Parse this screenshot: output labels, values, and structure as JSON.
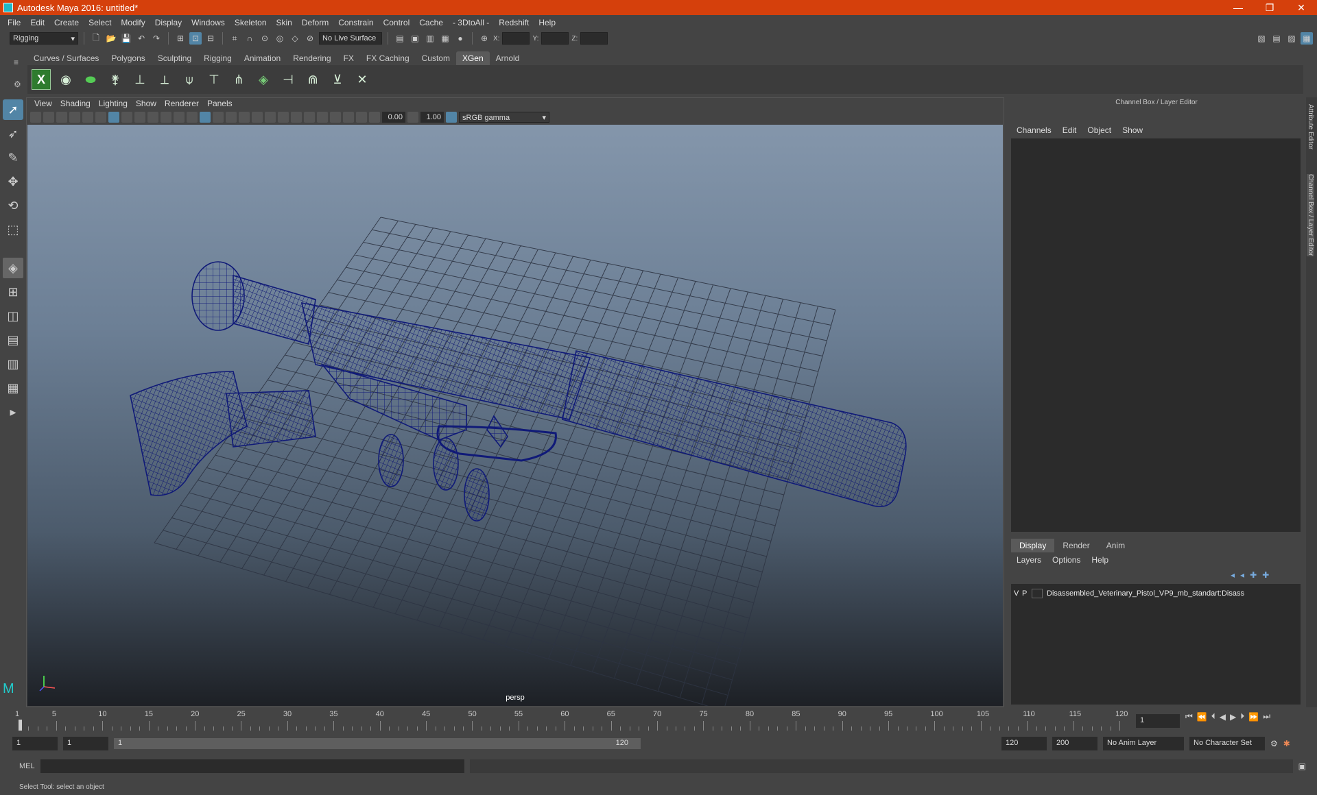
{
  "window": {
    "title": "Autodesk Maya 2016: untitled*"
  },
  "menubar": [
    "File",
    "Edit",
    "Create",
    "Select",
    "Modify",
    "Display",
    "Windows",
    "Skeleton",
    "Skin",
    "Deform",
    "Constrain",
    "Control",
    "Cache",
    "- 3DtoAll -",
    "Redshift",
    "Help"
  ],
  "statusline": {
    "menuset": "Rigging",
    "live_surface": "No Live Surface",
    "x_label": "X:",
    "y_label": "Y:",
    "z_label": "Z:"
  },
  "shelf": {
    "tabs": [
      "Curves / Surfaces",
      "Polygons",
      "Sculpting",
      "Rigging",
      "Animation",
      "Rendering",
      "FX",
      "FX Caching",
      "Custom",
      "XGen",
      "Arnold"
    ],
    "active_tab": "XGen",
    "icons": [
      "xgen-icon",
      "eye-icon",
      "leaf-icon",
      "guides-icon",
      "add-guide-icon",
      "place-icon",
      "sculpt-icon",
      "lock-icon",
      "grass-icon",
      "layers-icon",
      "spline-icon",
      "comb-icon",
      "cut-icon",
      "delete-icon"
    ]
  },
  "viewport": {
    "menu": [
      "View",
      "Shading",
      "Lighting",
      "Show",
      "Renderer",
      "Panels"
    ],
    "exposure": "0.00",
    "gamma": "1.00",
    "color_space": "sRGB gamma",
    "camera_label": "persp",
    "wire_color": "#101a78"
  },
  "channelbox": {
    "title": "Channel Box / Layer Editor",
    "menu": [
      "Channels",
      "Edit",
      "Object",
      "Show"
    ]
  },
  "layereditor": {
    "tabs": [
      "Display",
      "Render",
      "Anim"
    ],
    "active_tab": "Display",
    "menu": [
      "Layers",
      "Options",
      "Help"
    ],
    "layer": {
      "v": "V",
      "p": "P",
      "name": "Disassembled_Veterinary_Pistol_VP9_mb_standart:Disass"
    }
  },
  "sidetabs": {
    "attribute_editor": "Attribute Editor",
    "channel_box": "Channel Box / Layer Editor"
  },
  "timeline": {
    "labels": [
      "1",
      "5",
      "10",
      "15",
      "20",
      "25",
      "30",
      "35",
      "40",
      "45",
      "50",
      "55",
      "60",
      "65",
      "70",
      "75",
      "80",
      "85",
      "90",
      "95",
      "100",
      "105",
      "110",
      "115",
      "120"
    ],
    "current_frame": "1"
  },
  "range": {
    "start": "1",
    "current": "1",
    "range_start": "1",
    "range_end": "120",
    "end": "120",
    "max_end": "200",
    "anim_layer": "No Anim Layer",
    "character_set": "No Character Set"
  },
  "cmdline": {
    "label": "MEL"
  },
  "helpline": {
    "text": "Select Tool: select an object"
  }
}
